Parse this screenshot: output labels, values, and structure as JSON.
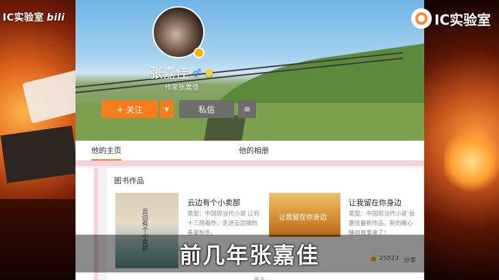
{
  "overlay": {
    "brand_left": "IC实验室",
    "brand_left_suffix": "bili",
    "brand_right": "IC实验室",
    "caption": "前几年张嘉佳"
  },
  "profile": {
    "name": "张嘉佳",
    "gender_symbol": "♂",
    "subtitle": "作家张嘉佳",
    "follow_label": "+ 关注",
    "message_label": "私信"
  },
  "tabs": [
    {
      "label": "他的主页"
    },
    {
      "label": "他的相册"
    }
  ],
  "books_section": {
    "title": "图书作品",
    "books": [
      {
        "title": "云边有个小卖部",
        "desc": "类型：中国现当代小说 让刘十三陪着你，走进云边镇的春夏秋冬。",
        "cover_text": "云边有个小卖部"
      },
      {
        "title": "让我留在你身边",
        "desc": "类型：中国现当代小说 张嘉佳最新作品，新的暖心睡前故事来了！",
        "cover_text": "让我留在你身边"
      }
    ],
    "likes": "25823",
    "share": "分享",
    "more": "更多"
  },
  "colors": {
    "accent_orange": "#f77c1b",
    "pink_band": "#f5d1dc"
  }
}
